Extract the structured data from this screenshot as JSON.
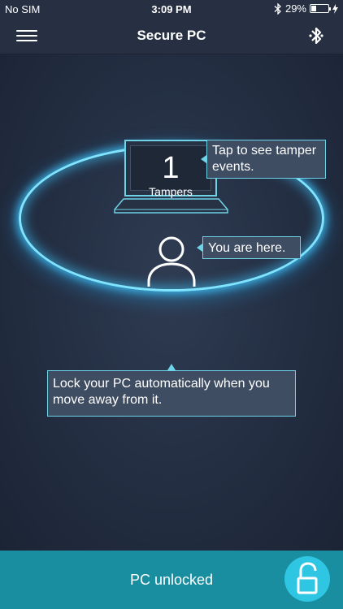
{
  "status_bar": {
    "carrier": "No SIM",
    "time": "3:09 PM",
    "battery_percent": "29%",
    "battery_level": 0.29,
    "icons": [
      "bluetooth-icon",
      "battery-icon",
      "charging-icon"
    ]
  },
  "nav": {
    "title": "Secure PC",
    "left_icon": "menu-icon",
    "right_icon": "bluetooth-icon"
  },
  "laptop": {
    "tamper_count": "1",
    "tamper_label": "Tampers"
  },
  "callouts": {
    "tamper": "Tap to see tamper events.",
    "here": "You are here.",
    "lock": "Lock your PC automatically when you move away from it."
  },
  "bottom": {
    "status": "PC unlocked",
    "lock_icon": "unlocked-padlock-icon"
  },
  "colors": {
    "background": "#1e2837",
    "nav": "#263042",
    "accent": "#6fd3e8",
    "ring_glow": "#40c8ff",
    "bottom_bar": "#1a8ea1",
    "lock_button": "#2fc6e3",
    "callout_bg": "#3f4d63"
  }
}
